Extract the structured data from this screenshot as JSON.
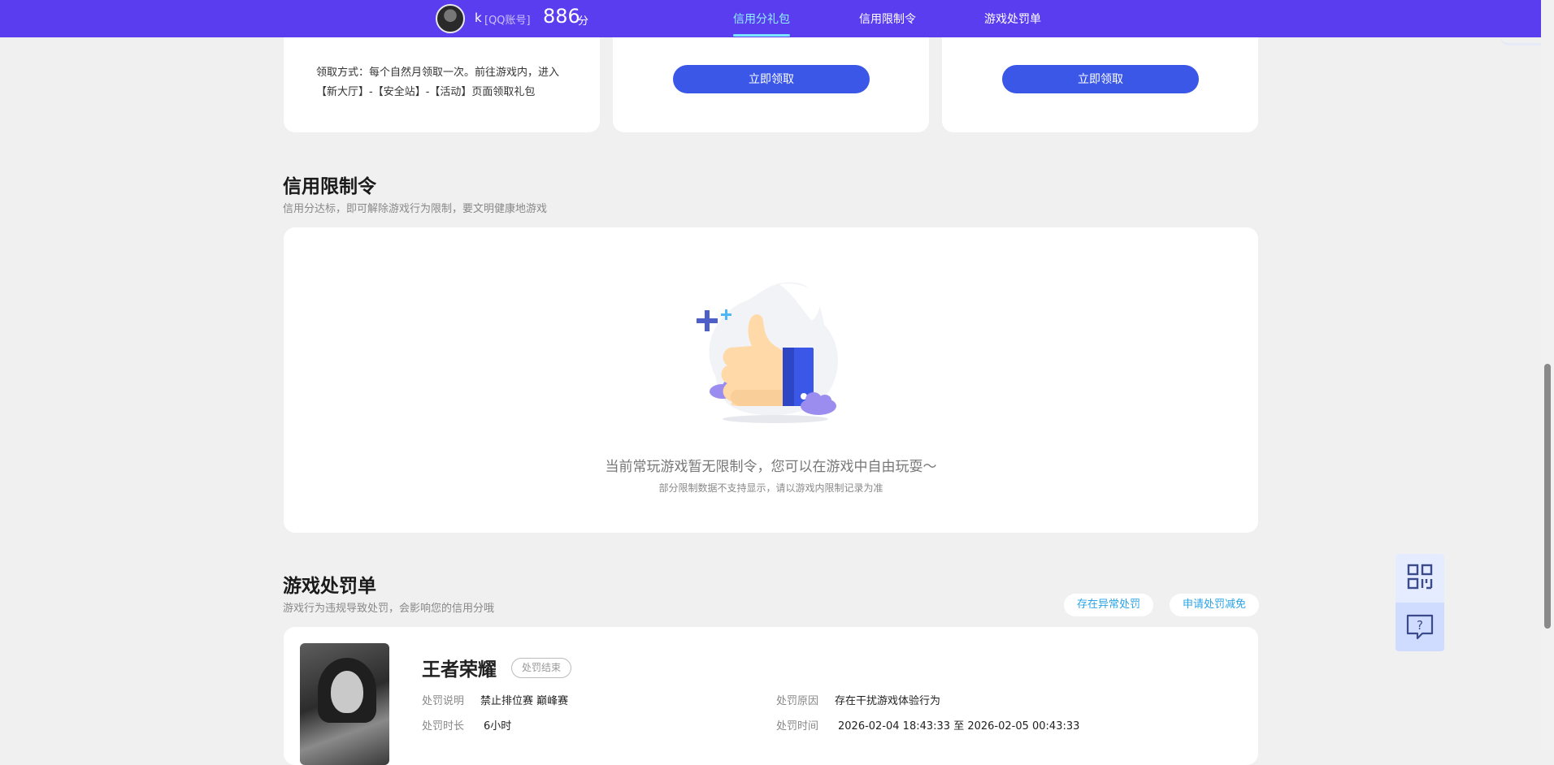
{
  "header": {
    "user_name": "k",
    "account_type": "[QQ账号]",
    "score": "886",
    "score_unit": "分",
    "tabs": [
      {
        "label": "信用分礼包",
        "active": true
      },
      {
        "label": "信用限制令",
        "active": false
      },
      {
        "label": "游戏处罚单",
        "active": false
      }
    ]
  },
  "gift_cards": {
    "claim_text": "领取方式：每个自然月领取一次。前往游戏内，进入【新大厅】-【安全站】-【活动】页面领取礼包",
    "claim_button_label": "立即领取"
  },
  "restriction": {
    "title": "信用限制令",
    "subtitle": "信用分达标，即可解除游戏行为限制，要文明健康地游戏",
    "empty_main": "当前常玩游戏暂无限制令，您可以在游戏中自由玩耍～",
    "empty_sub": "部分限制数据不支持显示，请以游戏内限制记录为准"
  },
  "penalty": {
    "title": "游戏处罚单",
    "subtitle": "游戏行为违规导致处罚，会影响您的信用分哦",
    "btn_abnormal": "存在异常处罚",
    "btn_reduce": "申请处罚减免",
    "record": {
      "game_name": "王者荣耀",
      "status": "处罚结束",
      "desc_label": "处罚说明",
      "desc_value": "禁止排位赛 巅峰赛",
      "duration_label": "处罚时长",
      "duration_value": "6小时",
      "reason_label": "处罚原因",
      "reason_value": "存在干扰游戏体验行为",
      "time_label": "处罚时间",
      "time_value": "2026-02-04 18:43:33 至 2026-02-05 00:43:33"
    }
  },
  "colors": {
    "header_bg": "#5b3df0",
    "primary_button": "#3a57e8",
    "active_tab": "#8ff0ff",
    "link": "#2aa3e8"
  },
  "icons": {
    "thumbs_up": "thumbs-up-illustration-icon",
    "qr": "qr-code-icon",
    "help": "help-chat-icon"
  }
}
